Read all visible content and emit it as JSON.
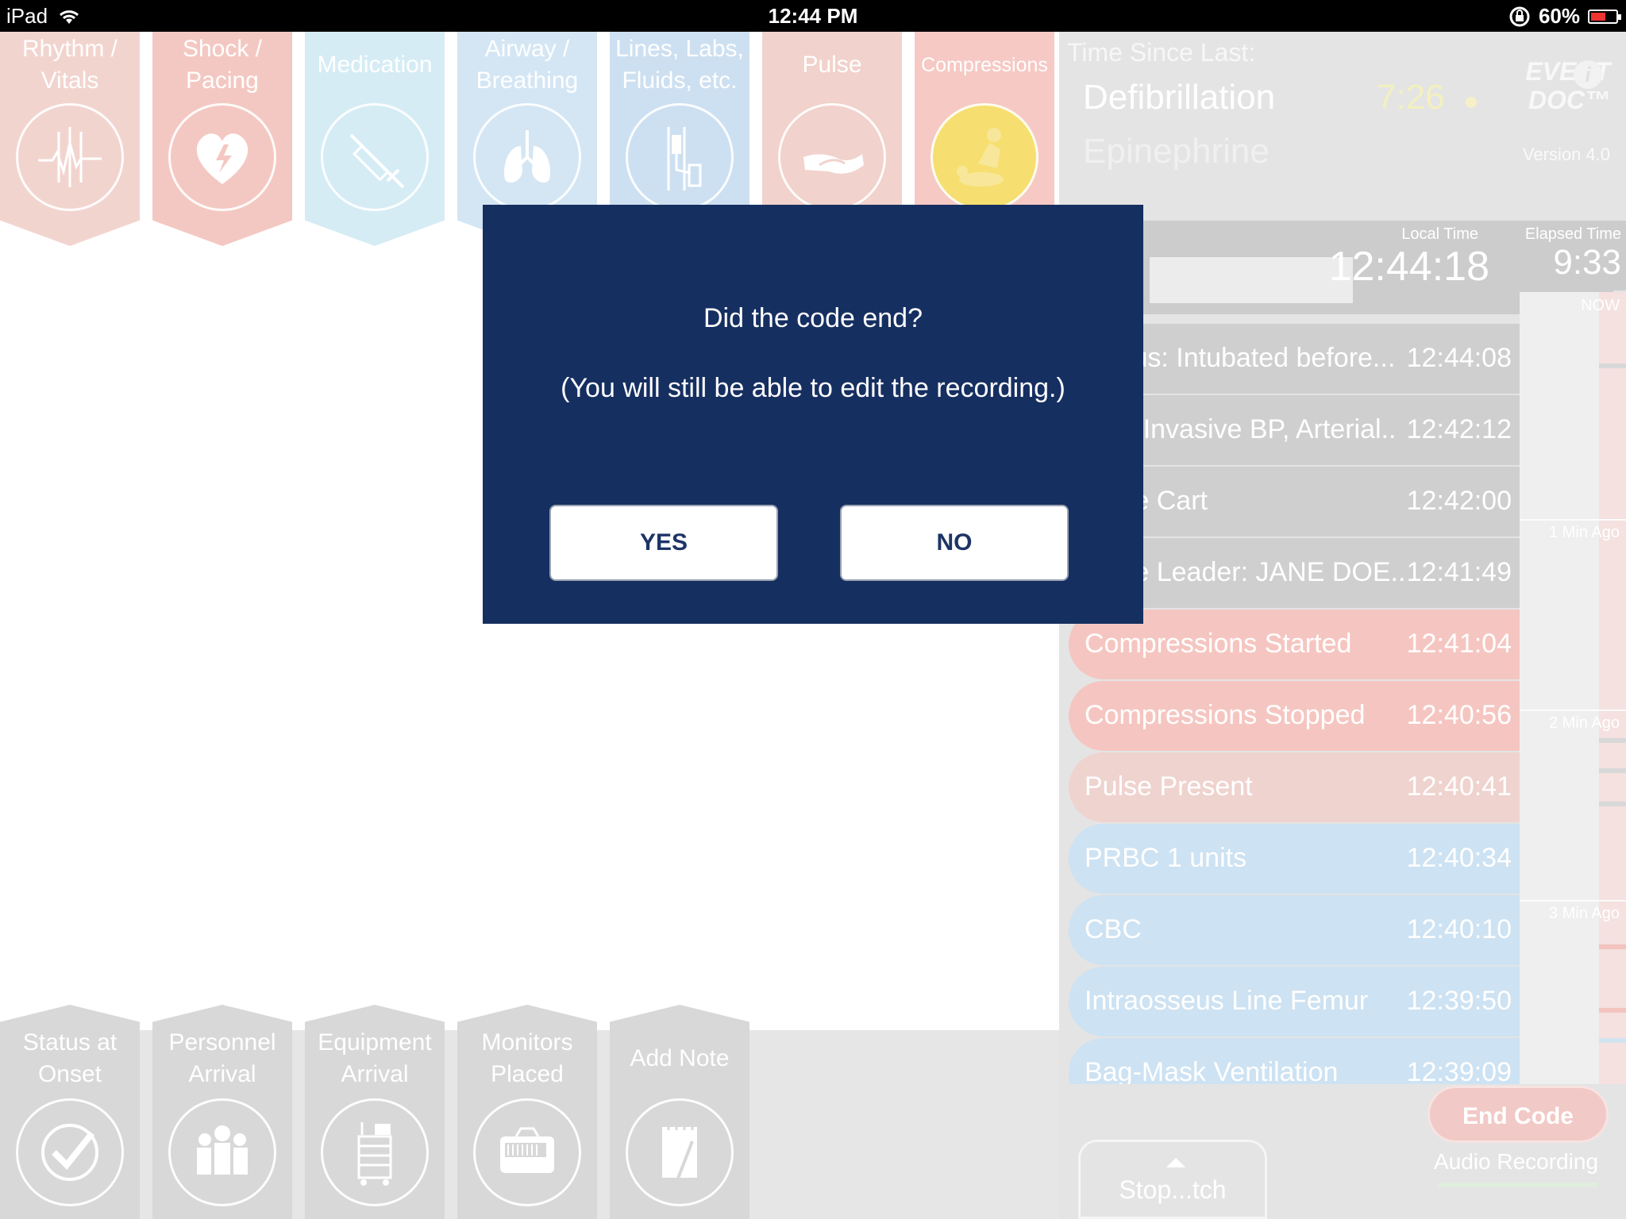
{
  "status_bar": {
    "device": "iPad",
    "time": "12:44 PM",
    "battery": "60%",
    "battery_level": 0.6
  },
  "top_tabs": [
    {
      "line1": "Rhythm /",
      "line2": "Vitals",
      "color": "#f2d4cf",
      "icon": "heartbeat-icon"
    },
    {
      "line1": "Shock /",
      "line2": "Pacing",
      "color": "#f4c8c2",
      "icon": "defib-heart-icon"
    },
    {
      "line1": "Medication",
      "line2": "",
      "color": "#d6ecf5",
      "icon": "syringe-icon"
    },
    {
      "line1": "Airway /",
      "line2": "Breathing",
      "color": "#d4e6f4",
      "icon": "lungs-icon"
    },
    {
      "line1": "Lines, Labs,",
      "line2": "Fluids, etc.",
      "color": "#cde0f1",
      "icon": "iv-drip-icon"
    },
    {
      "line1": "Pulse",
      "line2": "",
      "color": "#f1d2cc",
      "icon": "hand-pulse-icon"
    },
    {
      "line1": "Compressions",
      "line2": "",
      "color": "#f6c9c4",
      "icon": "cpr-icon"
    }
  ],
  "right_panel": {
    "title": "Time Since Last:",
    "defib_label": "Defibrillation",
    "defib_time": "7:26",
    "epi_label": "Epinephrine",
    "logo_line1": "EVENT",
    "logo_line2": "DOC™",
    "version": "Version 4.0",
    "local_time_label": "Local Time",
    "local_time": "12:44:18",
    "elapsed_label": "Elapsed Time",
    "elapsed_time": "9:33",
    "timeline_labels": [
      "NOW",
      "1 Min Ago",
      "2 Min Ago",
      "3 Min Ago"
    ],
    "events": [
      {
        "text": "Status:  Intubated before...",
        "time": "12:44:08",
        "kind": "gray"
      },
      {
        "text": "Non-Invasive BP, Arterial..",
        "time": "12:42:12",
        "kind": "gray"
      },
      {
        "text": "Code Cart",
        "time": "12:42:00",
        "kind": "gray"
      },
      {
        "text": "Code Leader: JANE DOE..",
        "time": "12:41:49",
        "kind": "gray"
      },
      {
        "text": "Compressions Started",
        "time": "12:41:04",
        "kind": "red"
      },
      {
        "text": "Compressions Stopped",
        "time": "12:40:56",
        "kind": "red"
      },
      {
        "text": "Pulse Present",
        "time": "12:40:41",
        "kind": "pink"
      },
      {
        "text": "PRBC 1 units",
        "time": "12:40:34",
        "kind": "blue"
      },
      {
        "text": "CBC",
        "time": "12:40:10",
        "kind": "blue"
      },
      {
        "text": "Intraosseus Line Femur",
        "time": "12:39:50",
        "kind": "blue"
      },
      {
        "text": "Bag-Mask Ventilation",
        "time": "12:39:09",
        "kind": "blue"
      }
    ],
    "end_code": "End Code",
    "audio_recording": "Audio Recording",
    "stopwatch": "Stop...tch"
  },
  "bottom_tabs": [
    {
      "line1": "Status at",
      "line2": "Onset",
      "icon": "checkmark-icon"
    },
    {
      "line1": "Personnel",
      "line2": "Arrival",
      "icon": "people-icon"
    },
    {
      "line1": "Equipment",
      "line2": "Arrival",
      "icon": "cart-icon"
    },
    {
      "line1": "Monitors",
      "line2": "Placed",
      "icon": "monitor-icon"
    },
    {
      "line1": "Add Note",
      "line2": "",
      "icon": "notepad-icon"
    }
  ],
  "dialog": {
    "question": "Did the code end?",
    "subtext": "(You will still be able to edit the recording.)",
    "yes": "YES",
    "no": "NO",
    "bg_color": "#162f61"
  }
}
